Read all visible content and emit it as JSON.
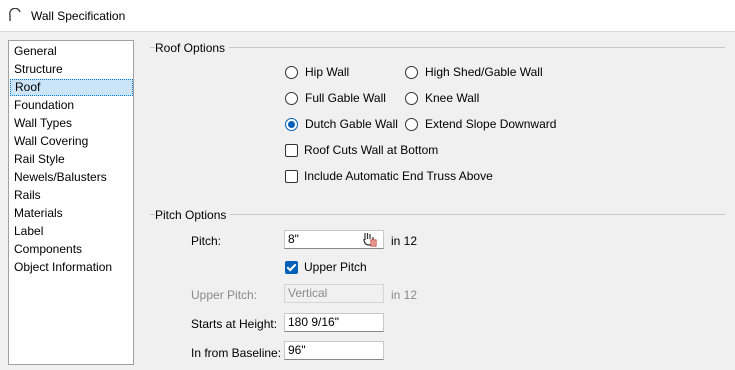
{
  "window": {
    "title": "Wall Specification",
    "icon": "wall-arc-icon"
  },
  "sidebar": {
    "items": [
      {
        "label": "General",
        "selected": false
      },
      {
        "label": "Structure",
        "selected": false
      },
      {
        "label": "Roof",
        "selected": true
      },
      {
        "label": "Foundation",
        "selected": false
      },
      {
        "label": "Wall Types",
        "selected": false
      },
      {
        "label": "Wall Covering",
        "selected": false
      },
      {
        "label": "Rail Style",
        "selected": false
      },
      {
        "label": "Newels/Balusters",
        "selected": false
      },
      {
        "label": "Rails",
        "selected": false
      },
      {
        "label": "Materials",
        "selected": false
      },
      {
        "label": "Label",
        "selected": false
      },
      {
        "label": "Components",
        "selected": false
      },
      {
        "label": "Object Information",
        "selected": false
      }
    ]
  },
  "roof_options": {
    "group_label": "Roof Options",
    "radios": [
      {
        "label": "Hip Wall",
        "checked": false
      },
      {
        "label": "High Shed/Gable Wall",
        "checked": false
      },
      {
        "label": "Full Gable Wall",
        "checked": false
      },
      {
        "label": "Knee Wall",
        "checked": false
      },
      {
        "label": "Dutch Gable Wall",
        "checked": true
      },
      {
        "label": "Extend Slope Downward",
        "checked": false
      }
    ],
    "roof_cuts_wall": {
      "label": "Roof Cuts Wall at Bottom",
      "checked": false
    },
    "include_end_truss": {
      "label": "Include Automatic End Truss Above",
      "checked": false
    }
  },
  "pitch_options": {
    "group_label": "Pitch Options",
    "pitch": {
      "label": "Pitch:",
      "value": "8\"",
      "suffix": "in 12",
      "calc_icon": "calculator-hand-icon"
    },
    "upper_pitch_check": {
      "label": "Upper Pitch",
      "checked": true
    },
    "upper_pitch": {
      "label": "Upper Pitch:",
      "value": "Vertical",
      "suffix": "in 12",
      "disabled": true
    },
    "starts_at_height": {
      "label": "Starts at Height:",
      "value": "180 9/16\""
    },
    "in_from_baseline": {
      "label": "In from Baseline:",
      "value": "96\""
    }
  },
  "colors": {
    "accent": "#005fb8",
    "selection": "#cce4f7"
  }
}
